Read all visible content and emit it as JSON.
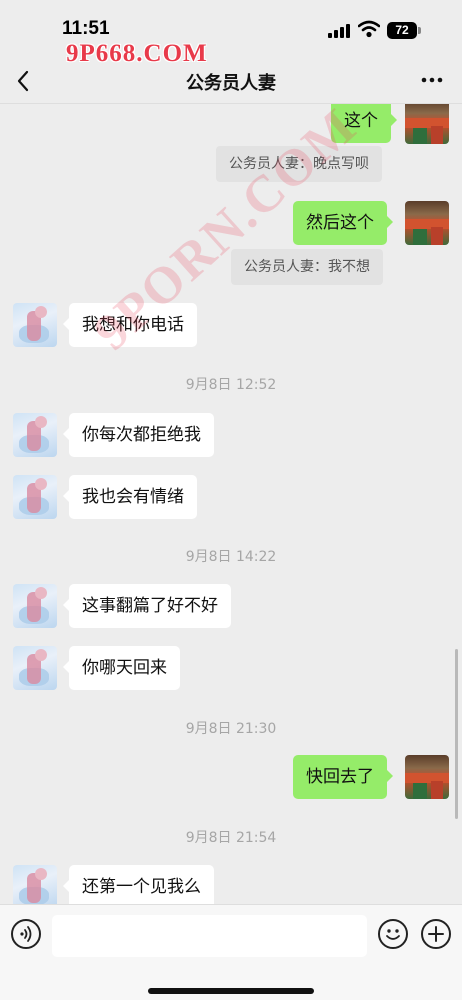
{
  "status": {
    "time": "11:51",
    "battery": "72"
  },
  "watermarks": {
    "top": "9P668.COM",
    "diagonal": "9PORN.COM"
  },
  "nav": {
    "title": "公务员人妻"
  },
  "messages": [
    {
      "side": "right",
      "text": "这个"
    },
    {
      "side": "quote",
      "text": "公务员人妻：晚点写呗"
    },
    {
      "side": "right",
      "text": "然后这个"
    },
    {
      "side": "quote",
      "text": "公务员人妻：我不想"
    },
    {
      "side": "left",
      "text": "我想和你电话"
    },
    {
      "side": "time",
      "text": "9月8日 12:52"
    },
    {
      "side": "left",
      "text": "你每次都拒绝我"
    },
    {
      "side": "left",
      "text": "我也会有情绪"
    },
    {
      "side": "time",
      "text": "9月8日 14:22"
    },
    {
      "side": "left",
      "text": "这事翻篇了好不好"
    },
    {
      "side": "left",
      "text": "你哪天回来"
    },
    {
      "side": "time",
      "text": "9月8日 21:30"
    },
    {
      "side": "right",
      "text": "快回去了"
    },
    {
      "side": "time",
      "text": "9月8日 21:54"
    },
    {
      "side": "left",
      "text": "还第一个见我么"
    }
  ],
  "input": {
    "value": "",
    "placeholder": ""
  },
  "icons": {
    "back": "chevron-left-icon",
    "more": "more-dots-icon",
    "voice": "voice-icon",
    "emoji": "emoji-icon",
    "plus": "plus-icon"
  }
}
